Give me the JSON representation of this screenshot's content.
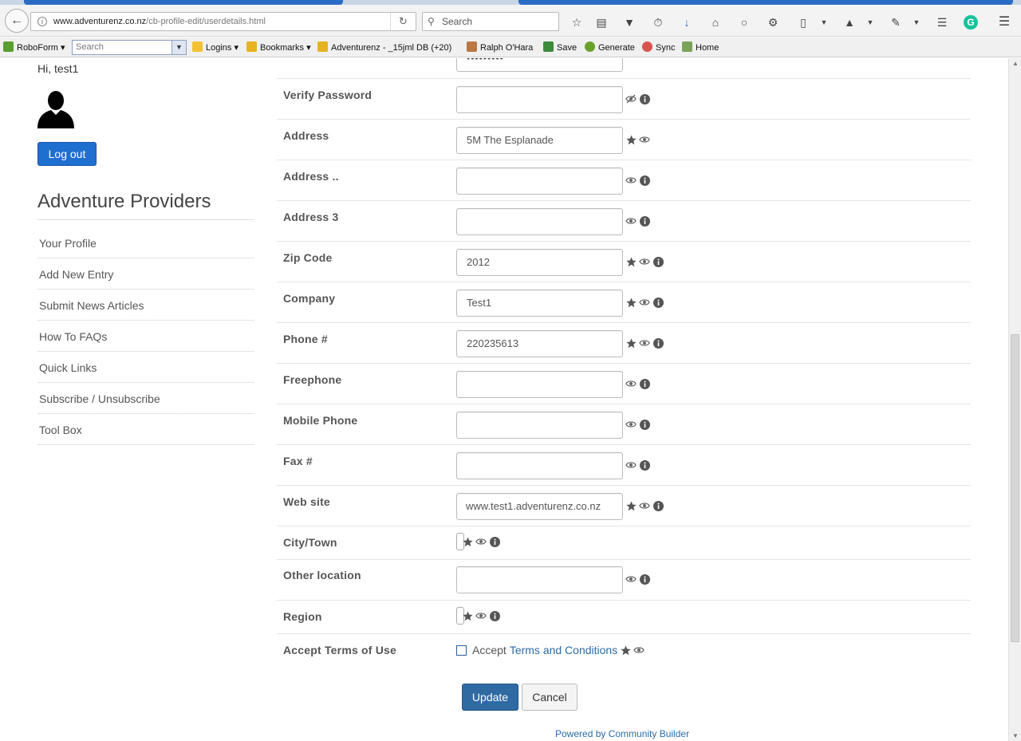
{
  "browser": {
    "url_host": "www.adventurenz.co.nz",
    "url_path": "/cb-profile-edit/userdetails.html",
    "search_placeholder": "Search"
  },
  "bookmarks_bar": {
    "roboform": "RoboForm",
    "search_placeholder": "Search",
    "logins": "Logins",
    "bookmarks": "Bookmarks",
    "adventurenz": "Adventurenz - _15jml DB",
    "adventurenz_count": "(+20)",
    "ralph": "Ralph O'Hara",
    "save": "Save",
    "generate": "Generate",
    "sync": "Sync",
    "home": "Home"
  },
  "sidebar": {
    "greeting": "Hi, test1",
    "logout": "Log out",
    "title": "Adventure Providers",
    "items": [
      {
        "label": "Your Profile"
      },
      {
        "label": "Add New Entry"
      },
      {
        "label": "Submit News Articles"
      },
      {
        "label": "How To FAQs"
      },
      {
        "label": "Quick Links"
      },
      {
        "label": "Subscribe / Unsubscribe"
      },
      {
        "label": "Tool Box"
      }
    ]
  },
  "form": {
    "password_value": "•••••••••",
    "fields": [
      {
        "label": "Verify Password",
        "value": ""
      },
      {
        "label": "Address",
        "value": "5M The Esplanade"
      },
      {
        "label": "Address ..",
        "value": ""
      },
      {
        "label": "Address 3",
        "value": ""
      },
      {
        "label": "Zip Code",
        "value": "2012"
      },
      {
        "label": "Company",
        "value": "Test1"
      },
      {
        "label": "Phone #",
        "value": "220235613"
      },
      {
        "label": "Freephone",
        "value": ""
      },
      {
        "label": "Mobile Phone",
        "value": ""
      },
      {
        "label": "Fax #",
        "value": ""
      },
      {
        "label": "Web site",
        "value": "www.test1.adventurenz.co.nz"
      },
      {
        "label": "City/Town",
        "value": ""
      },
      {
        "label": "Other location",
        "value": ""
      },
      {
        "label": "Region",
        "value": ""
      },
      {
        "label": "Accept Terms of Use",
        "value": ""
      }
    ],
    "terms_accept": "Accept",
    "terms_link": "Terms and Conditions",
    "update": "Update",
    "cancel": "Cancel",
    "powered_by": "Powered by Community Builder"
  },
  "colors": {
    "primary_button": "#1f6fd0",
    "update_button": "#2f6aa3",
    "link": "#2b6ca8"
  }
}
